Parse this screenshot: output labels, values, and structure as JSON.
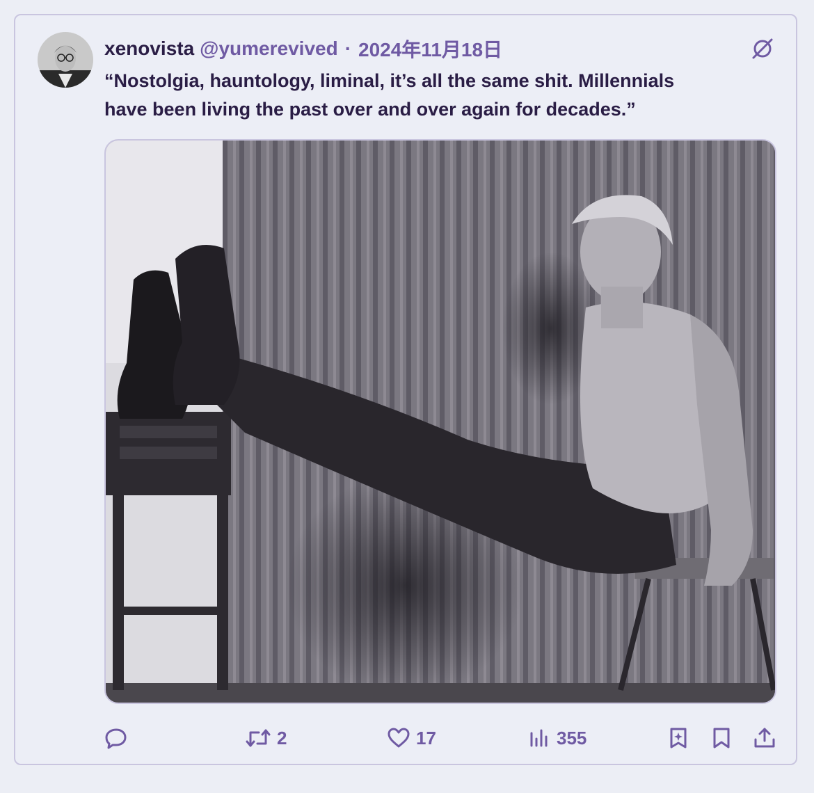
{
  "tweet": {
    "display_name": "xenovista",
    "handle": "@yumerevived",
    "separator": "·",
    "date": "2024年11月18日",
    "text_line1": "“Nostolgia, hauntology, liminal, it’s all the same shit. Millennials",
    "text_line2": "have been living the past over and over again for decades.”",
    "top_icon": "no-symbol-icon"
  },
  "media": {
    "description_icon": "photo",
    "tone": "black-and-white"
  },
  "actions": {
    "reply": {
      "icon": "reply-icon",
      "count": ""
    },
    "retweet": {
      "icon": "retweet-icon",
      "count": "2"
    },
    "like": {
      "icon": "heart-icon",
      "count": "17"
    },
    "views": {
      "icon": "views-icon",
      "count": "355"
    },
    "grok": {
      "icon": "grok-icon"
    },
    "bookmark": {
      "icon": "bookmark-icon"
    },
    "share": {
      "icon": "share-icon"
    }
  },
  "colors": {
    "accent": "#6f5aa3",
    "text": "#2a1d45",
    "background": "#eceef6",
    "border": "#c9c5df"
  }
}
